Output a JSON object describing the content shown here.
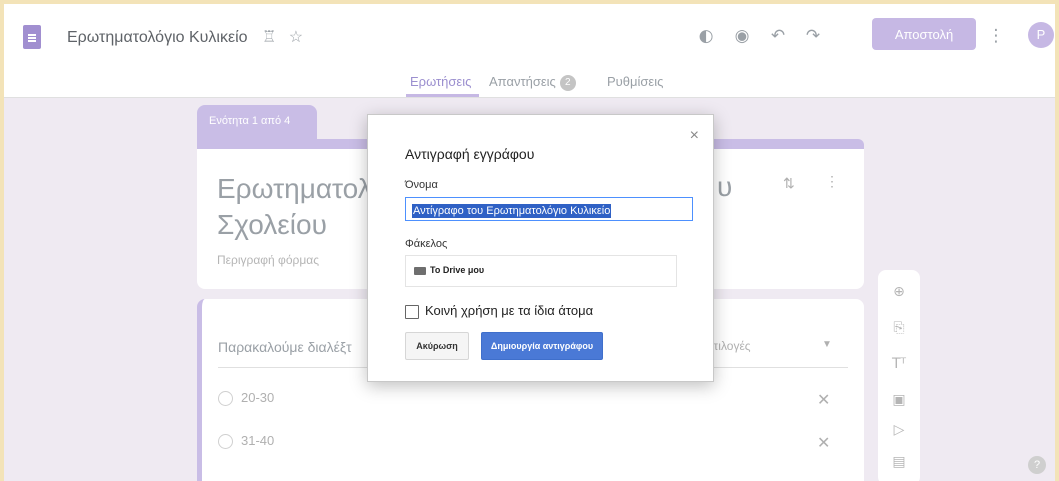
{
  "header": {
    "doc_title": "Ερωτηματολόγιο Κυλικείο",
    "send_label": "Αποστολή",
    "avatar_letter": "P",
    "icons": [
      "palette-icon",
      "eye-icon",
      "undo-icon",
      "redo-icon",
      "more-vert-icon"
    ]
  },
  "tabs": [
    {
      "label": "Ερωτήσεις",
      "active": true
    },
    {
      "label": "Απαντήσεις",
      "badge": "2"
    },
    {
      "label": "Ρυθμίσεις"
    }
  ],
  "form": {
    "section_label": "Ενότητα 1 από 4",
    "title_start": "Ερωτηματολ",
    "title_line2": "Σχολείου",
    "title_tail": "υ",
    "description": "Περιγραφή φόρμας",
    "question_placeholder": "Παρακαλούμε διαλέξτ",
    "question_type": "πιλογές",
    "options": [
      "20-30",
      "31-40"
    ]
  },
  "dialog": {
    "title": "Αντιγραφή εγγράφου",
    "name_label": "Όνομα",
    "name_value": "Αντίγραφο του Ερωτηματολόγιο Κυλικείο",
    "folder_label": "Φάκελος",
    "folder_value": "To Drive μου",
    "share_label": "Κοινή χρήση με τα ίδια άτομα",
    "cancel_label": "Ακύρωση",
    "create_label": "Δημιουργία αντιγράφου",
    "close_glyph": "×"
  },
  "colors": {
    "accent": "#c6b8e4",
    "primary_button": "#4a79d6",
    "selection": "#2f61c5"
  }
}
